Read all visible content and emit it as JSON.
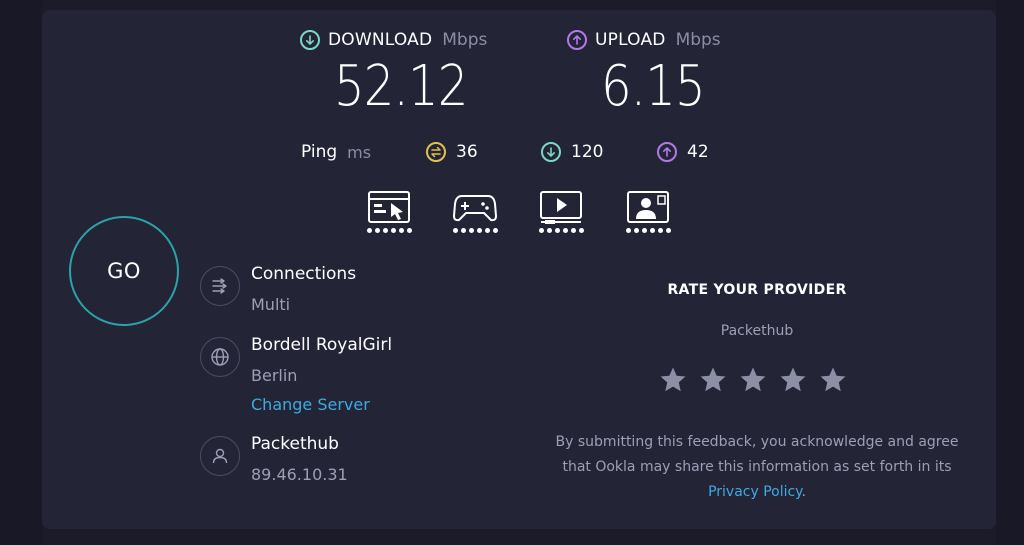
{
  "download": {
    "label": "DOWNLOAD",
    "unit": "Mbps",
    "value": "52.12",
    "color": "#7ad7c4"
  },
  "upload": {
    "label": "UPLOAD",
    "unit": "Mbps",
    "value": "6.15",
    "color": "#b07ae6"
  },
  "ping": {
    "label": "Ping",
    "unit": "ms",
    "idle": {
      "value": "36",
      "color": "#e1c24a"
    },
    "download": {
      "value": "120",
      "color": "#7ad7c4"
    },
    "upload": {
      "value": "42",
      "color": "#b07ae6"
    }
  },
  "usage_icons": [
    {
      "name": "web-browsing-icon",
      "rating": 6,
      "max": 6
    },
    {
      "name": "gaming-icon",
      "rating": 6,
      "max": 6
    },
    {
      "name": "video-streaming-icon",
      "rating": 6,
      "max": 6
    },
    {
      "name": "video-call-icon",
      "rating": 6,
      "max": 6
    }
  ],
  "go_label": "GO",
  "connections": {
    "title": "Connections",
    "value": "Multi"
  },
  "server": {
    "name": "Bordell RoyalGirl",
    "location": "Berlin",
    "change_label": "Change Server"
  },
  "provider": {
    "name": "Packethub",
    "ip": "89.46.10.31"
  },
  "rating": {
    "title": "RATE YOUR PROVIDER",
    "provider": "Packethub",
    "stars": 0,
    "max_stars": 5,
    "disclaimer_text": "By submitting this feedback, you acknowledge and agree that Ookla may share this information as set forth in its",
    "privacy_link": "Privacy Policy",
    "disclaimer_end": "."
  },
  "colors": {
    "accent_link": "#3fa9e0",
    "go_ring": "#2aa3a8",
    "card_bg": "#232537"
  }
}
